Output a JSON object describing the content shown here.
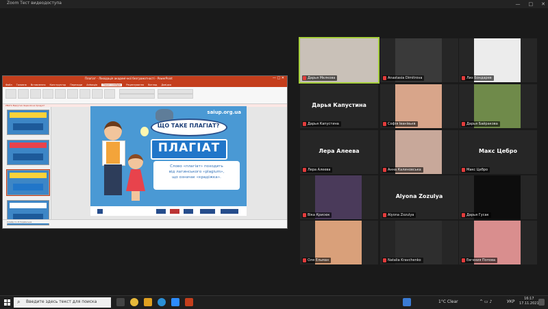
{
  "window": {
    "title": "Zoom Тест видеодоступа",
    "minimize": "—",
    "maximize": "□",
    "close": "✕"
  },
  "ppt": {
    "title": "Плагіат - Ліквідація академічної безграмотності - PowerPoint",
    "tabs": [
      "Файл",
      "Головна",
      "Вставлення",
      "Конструктор",
      "Переходи",
      "Анімація",
      "Показ слайдів",
      "Рецензування",
      "Вигляд",
      "Довідка"
    ],
    "active_tab": "Показ слайдів",
    "notice": "УВАГА Відсутня ліцензія на продукт",
    "status": "Слайд 4 з 8  Українська"
  },
  "slide": {
    "site": "saiup.org.ua",
    "question": "ЩО ТАКЕ ПЛАГІАТ?",
    "banner": "ПЛАГІАТ",
    "line1": "Слово «плагіат» походить",
    "line2": "від латинського «plagium»,",
    "line3": "що означає «крадіжка»."
  },
  "participants": [
    {
      "name": "Дарья Мелкова",
      "display": "",
      "color": "#c9c1b8"
    },
    {
      "name": "Anastasia Dimitrova",
      "display": "",
      "color": "#3a3a3a"
    },
    {
      "name": "Лиз Бондарев",
      "display": "",
      "color": "#ececec"
    },
    {
      "name": "Дарья Капустина",
      "display": "Дарья Капустина",
      "color": ""
    },
    {
      "name": "Софія Іванівьєв",
      "display": "",
      "color": "#d8a58a"
    },
    {
      "name": "Дарья Байракова",
      "display": "",
      "color": "#6f8a4a"
    },
    {
      "name": "Лера Алеева",
      "display": "Лера Алеева",
      "color": ""
    },
    {
      "name": "Анна Калиновська",
      "display": "",
      "color": "#c8a89a"
    },
    {
      "name": "Макс Цебро",
      "display": "Макс Цебро",
      "color": ""
    },
    {
      "name": "Віка Крисюк",
      "display": "",
      "color": "#4a3a5a"
    },
    {
      "name": "Alyona Zozulya",
      "display": "Alyona Zozulya",
      "color": ""
    },
    {
      "name": "Дарья Гусак",
      "display": "",
      "color": "#0d0d0d"
    },
    {
      "name": "Оля Ельман",
      "display": "",
      "color": "#d9a07a"
    },
    {
      "name": "Natalia Kravchenko",
      "display": "",
      "color": "#2e2e2e"
    },
    {
      "name": "Евгения Попова",
      "display": "",
      "color": "#d98e8e"
    }
  ],
  "taskbar": {
    "search_placeholder": "Введите здесь текст для поиска",
    "weather": "1°C Clear",
    "lang": "УКР",
    "time": "16:17",
    "date": "17.11.2021"
  }
}
